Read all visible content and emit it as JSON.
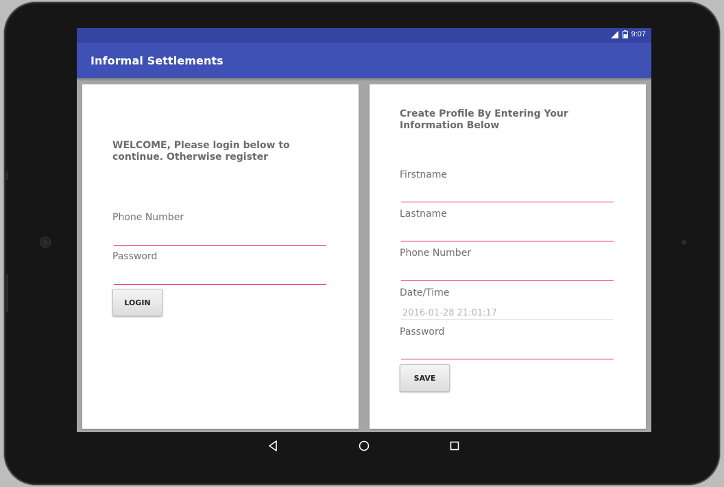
{
  "status": {
    "time": "9:07"
  },
  "app": {
    "title": "Informal Settlements"
  },
  "login": {
    "heading": "WELCOME, Please login below to continue. Otherwise register",
    "phone_label": "Phone Number",
    "password_label": "Password",
    "login_button": "LOGIN"
  },
  "register": {
    "heading": "Create Profile By Entering Your Information Below",
    "firstname_label": "Firstname",
    "lastname_label": "Lastname",
    "phone_label": "Phone Number",
    "datetime_label": "Date/Time",
    "datetime_value": "2016-01-28 21:01:17",
    "password_label": "Password",
    "save_button": "SAVE"
  },
  "colors": {
    "primary": "#3f51b5",
    "primary_dark": "#3344a3",
    "accent": "#e91e63"
  },
  "icons": [
    "signal-icon",
    "battery-icon",
    "back-icon",
    "home-icon",
    "recents-icon"
  ]
}
